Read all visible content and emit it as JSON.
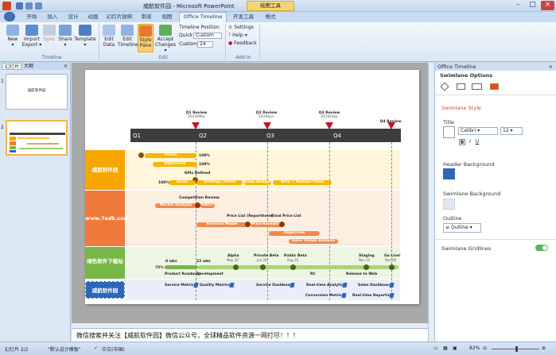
{
  "window": {
    "title": "威航软件园 - Microsoft PowerPoint",
    "context_tab": "绘图工具"
  },
  "tabs": [
    "开始",
    "插入",
    "设计",
    "动画",
    "幻灯片放映",
    "审阅",
    "视图",
    "Office Timeline Pro",
    "开发工具",
    "格式"
  ],
  "ribbon": {
    "timeline_buttons": [
      {
        "label": "New",
        "sub": "▾"
      },
      {
        "label": "Import",
        "sub": "Export ▾"
      },
      {
        "label": "Sync",
        "sub": ""
      },
      {
        "label": "Share",
        "sub": "▾"
      },
      {
        "label": "Template",
        "sub": "▾"
      }
    ],
    "edit_buttons": [
      {
        "label": "Edit",
        "sub": "Data"
      },
      {
        "label": "Edit",
        "sub": "Timeline"
      },
      {
        "label": "Style",
        "sub": "Pane"
      },
      {
        "label": "Accept",
        "sub": "Changes ▾"
      }
    ],
    "timeline_position_label": "Timeline Position",
    "quick_label": "Quick",
    "quick_value": "Custom",
    "custom_label": "Custom",
    "custom_value": "24",
    "settings_label": "Settings",
    "help_label": "Help ▾",
    "feedback_label": "Feedback",
    "groups": [
      "Timeline",
      "Edit",
      "Add-In"
    ]
  },
  "left_panel": {
    "tab_slides": "幻灯片",
    "tab_outline": "大纲",
    "thumb1_text": "威航软件园",
    "thumb_numbers": [
      "1",
      "2"
    ]
  },
  "slide": {
    "quarters": [
      "Q1",
      "Q2",
      "Q3",
      "Q4"
    ],
    "milestones": [
      {
        "label": "Q1 Review",
        "date": "2019/Mar"
      },
      {
        "label": "Q2 Review",
        "date": "2019/Jun"
      },
      {
        "label": "Q3 Review",
        "date": "2019/Sep"
      },
      {
        "label": "Q4 Review",
        "date": ""
      }
    ],
    "swimlanes": [
      "威航软件园",
      "www.7edk.com",
      "绿色软件下载站",
      "威航软件园"
    ],
    "lane1": {
      "vision": "Vision",
      "vision_pct": "100%",
      "objectives": "Objectives",
      "objectives_pct": "100%",
      "kpis": "KPIs Defined",
      "goals_pct": "100%",
      "goals": "Goals",
      "strategic": "Strategic Intent",
      "sales_budget": "Sales Budget",
      "beta": "Beta + Release Plans"
    },
    "lane2": {
      "comp_review": "Competition Review",
      "market_analysis": "Market Analysis",
      "swot": "SWOT",
      "price_list": "Price List (Reportheim)",
      "final_price": "Final Price List",
      "revenue_model": "Revenue Model",
      "price_research": "Price Research",
      "objectives": "Objectives",
      "sales_trends": "Sales Trends Analysis"
    },
    "lane3": {
      "alpha": "Alpha",
      "alpha_date": "May 20",
      "private_beta": "Private Beta",
      "private_date": "Jun 20",
      "public_beta": "Public Beta",
      "public_date": "Aug 10",
      "staging": "Staging",
      "staging_date": "Nov 15",
      "golive": "Go Live!",
      "golive_date": "Dec 20",
      "wks0": "0 wks",
      "wks22": "22 wks",
      "pct": "75%",
      "product_roadmap": "Product Roadmap",
      "development": "Development",
      "rc": "RC",
      "release": "Release to Web"
    },
    "lane4": {
      "service_metrics": "Service Metrics",
      "quality_metrics": "Quality Metrics",
      "service_dashboard": "Service Dashboard",
      "realtime_analytics": "Real-time Analytics",
      "sales_dashboard": "Sales Dashboard",
      "conversion_metrics": "Conversion Metrics",
      "realtime_reporting": "Real-time Reporting"
    }
  },
  "notes_text": "微信搜索并关注【威航软件园】微信公众号，全球精品软件资源一网打尽！！！",
  "right_panel": {
    "title": "Office Timeline",
    "section": "Swimlane Options",
    "style_title": "Swimlane Style",
    "title_label": "Title",
    "font": "Calibri",
    "font_size": "12",
    "bold": "B",
    "italic": "I",
    "underline": "U",
    "header_bg": "Header Background",
    "swimlane_bg": "Swimlane Background",
    "outline_label": "Outline",
    "outline_value": "Outline",
    "gridlines": "Swimlane Gridlines"
  },
  "status": {
    "slide_info": "幻灯片 2/2",
    "theme": "\"默认设计模板\"",
    "lang": "中文(中国)",
    "zoom": "82%"
  },
  "colors": {
    "lane1": "#f7a600",
    "lane2": "#f07a3a",
    "lane3": "#77b748",
    "lane4": "#2f67b8",
    "milestone": "#c8102e"
  }
}
